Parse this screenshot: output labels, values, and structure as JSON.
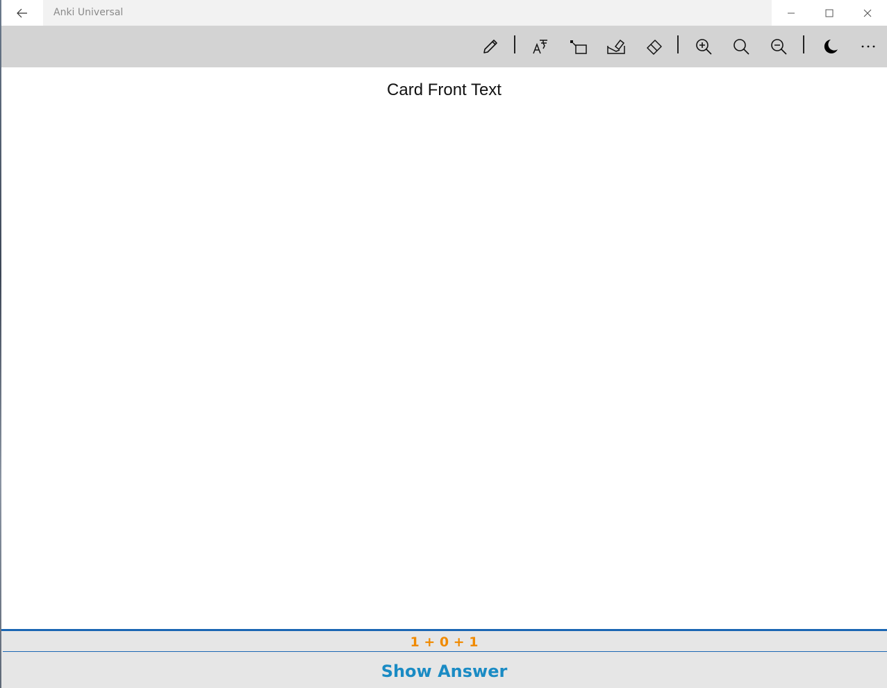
{
  "window": {
    "title": "Anki Universal"
  },
  "icons": {
    "back": "arrow-left-icon",
    "minimize": "minimize-icon",
    "maximize": "maximize-icon",
    "close": "close-icon",
    "pen": "pencil-icon",
    "text_style": "text-format-icon",
    "crop": "crop-icon",
    "eraser_ink": "ink-eraser-icon",
    "eraser": "eraser-icon",
    "zoom_in": "zoom-in-icon",
    "zoom_reset": "zoom-icon",
    "zoom_out": "zoom-out-icon",
    "night_mode": "moon-icon",
    "more": "more-icon"
  },
  "card": {
    "front_text": "Card Front Text"
  },
  "review": {
    "counts": "1 + 0 + 1",
    "show_answer_label": "Show Answer"
  },
  "colors": {
    "accent_blue": "#1a66b3",
    "count_orange": "#f08a00",
    "answer_blue": "#1a8bc4",
    "toolbar_gray": "#d3d3d3"
  }
}
